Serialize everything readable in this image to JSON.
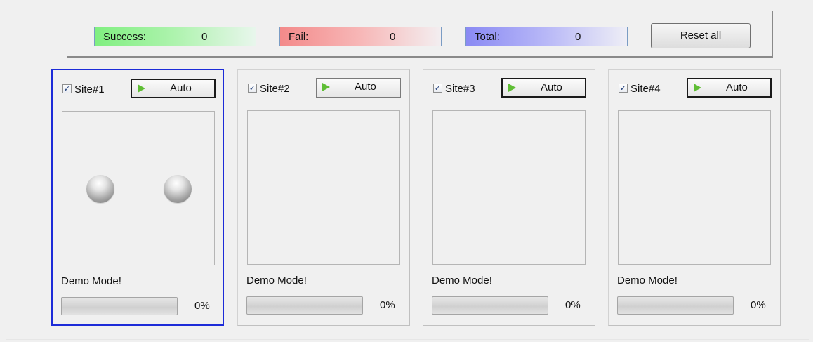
{
  "counters": {
    "success": {
      "label": "Success:",
      "value": "0"
    },
    "fail": {
      "label": "Fail:",
      "value": "0"
    },
    "total": {
      "label": "Total:",
      "value": "0"
    }
  },
  "reset_label": "Reset all",
  "sites": [
    {
      "label": "Site#1",
      "checked": true,
      "auto_label": "Auto",
      "mode": "Demo Mode!",
      "progress": 0,
      "progress_text": "0%"
    },
    {
      "label": "Site#2",
      "checked": true,
      "auto_label": "Auto",
      "mode": "Demo Mode!",
      "progress": 0,
      "progress_text": "0%"
    },
    {
      "label": "Site#3",
      "checked": true,
      "auto_label": "Auto",
      "mode": "Demo Mode!",
      "progress": 0,
      "progress_text": "0%"
    },
    {
      "label": "Site#4",
      "checked": true,
      "auto_label": "Auto",
      "mode": "Demo Mode!",
      "progress": 0,
      "progress_text": "0%"
    }
  ],
  "icons": {
    "auto_button": "play-icon",
    "indicator": "led-indicator-icon"
  },
  "colors": {
    "success": "#80ef80",
    "fail": "#f38a8a",
    "total": "#8a8af3",
    "active_border": "#1c2bd8",
    "play": "#5fbe35"
  }
}
